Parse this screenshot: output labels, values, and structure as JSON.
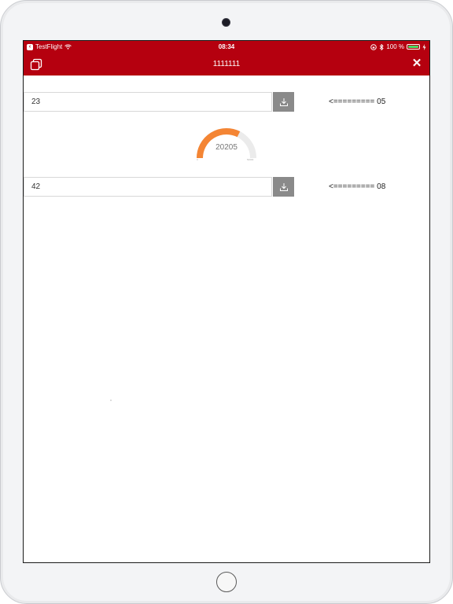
{
  "status_bar": {
    "app_back": "TestFlight",
    "time": "08:34",
    "battery": "100 %"
  },
  "nav": {
    "title": "1111111"
  },
  "rows": [
    {
      "value": "23",
      "label": "<========= 05"
    },
    {
      "value": "42",
      "label": "<========= 08"
    }
  ],
  "gauge": {
    "value": "20205",
    "min_label": "0",
    "max_label": "50000",
    "fraction": 0.65,
    "color": "#f48534",
    "track_color": "#ebebeb"
  },
  "colors": {
    "brand": "#b5000f",
    "button": "#8a8a8a"
  }
}
